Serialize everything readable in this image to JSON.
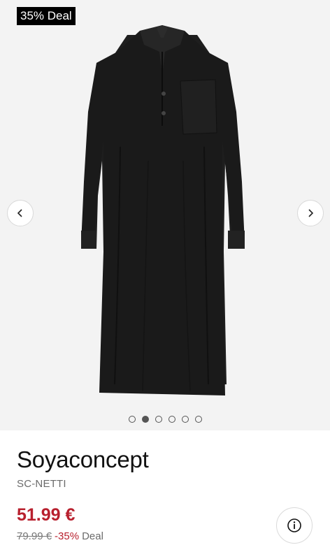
{
  "gallery": {
    "badge": "35% Deal",
    "dots_count": 6,
    "active_index": 1,
    "product_color": "#1c1c1c",
    "icons": {
      "prev": "chevron-left-icon",
      "next": "chevron-right-icon"
    }
  },
  "product": {
    "brand": "Soyaconcept",
    "model": "SC-NETTI",
    "price": "51.99 €",
    "old_price": "79.99 €",
    "discount": "-35%",
    "deal_label": "Deal",
    "info_icon": "info-icon"
  },
  "colors": {
    "sale_red": "#b8202e",
    "gallery_bg": "#f3f3f3"
  }
}
